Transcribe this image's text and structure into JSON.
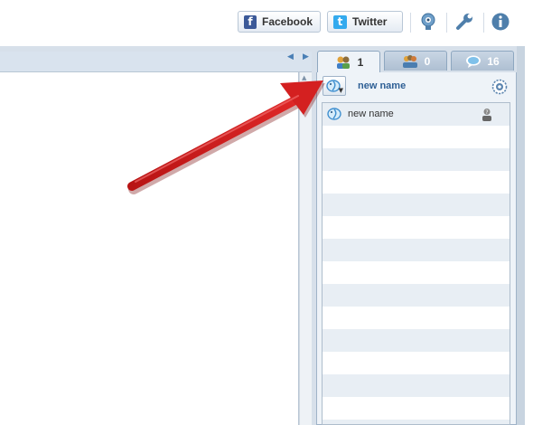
{
  "toolbar": {
    "facebook_label": "Facebook",
    "twitter_label": "Twitter"
  },
  "tabs": [
    {
      "icon": "users-icon",
      "count": "1"
    },
    {
      "icon": "group-icon",
      "count": "0"
    },
    {
      "icon": "speech-bubble-icon",
      "count": "16"
    }
  ],
  "panel": {
    "current_user_name": "new name"
  },
  "users": [
    {
      "name": "new name",
      "icon": "bird-icon",
      "status_icon": "unknown-user-icon"
    }
  ],
  "colors": {
    "facebook": "#3b5998",
    "twitter": "#33aaee",
    "link_blue": "#2e5f95",
    "arrow_red": "#cc1d1d"
  }
}
